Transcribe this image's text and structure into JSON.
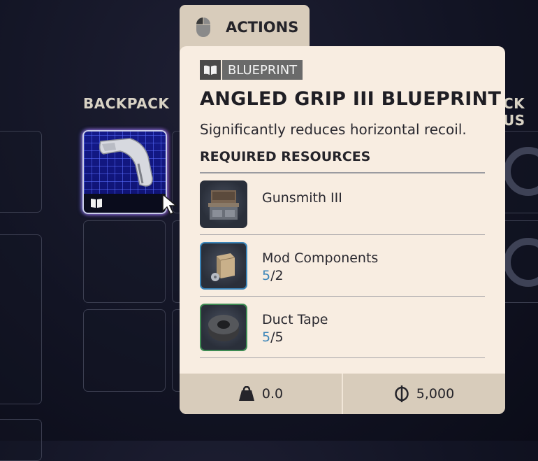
{
  "sections": {
    "backpack_label": "BACKPACK",
    "right_label": "CK US"
  },
  "backpack_item": {
    "icon": "blueprint-book-icon"
  },
  "actions_tab": {
    "icon": "mouse-icon",
    "label": "ACTIONS"
  },
  "tooltip": {
    "badge": {
      "icon": "book-icon",
      "label": "BLUEPRINT"
    },
    "title": "ANGLED GRIP III BLUEPRINT",
    "description": "Significantly reduces horizontal recoil.",
    "required_header": "REQUIRED RESOURCES",
    "resources": [
      {
        "name": "Gunsmith III",
        "have": "",
        "sep": "",
        "need": "",
        "thumb": "workbench",
        "rarity_color": "#2a2f3a"
      },
      {
        "name": "Mod Components",
        "have": "5",
        "sep": "/",
        "need": "2",
        "thumb": "box-parts",
        "rarity_color": "#3a84b8"
      },
      {
        "name": "Duct Tape",
        "have": "5",
        "sep": "/",
        "need": "5",
        "thumb": "tape-roll",
        "rarity_color": "#3d8a52"
      }
    ],
    "footer": {
      "weight_icon": "weight-icon",
      "weight": "0.0",
      "value_icon": "currency-icon",
      "value": "5,000"
    }
  },
  "colors": {
    "background": "#121424",
    "card": "#f8ede1",
    "card_footer": "#d8ccbb",
    "quantity_have": "#3a84b8"
  }
}
